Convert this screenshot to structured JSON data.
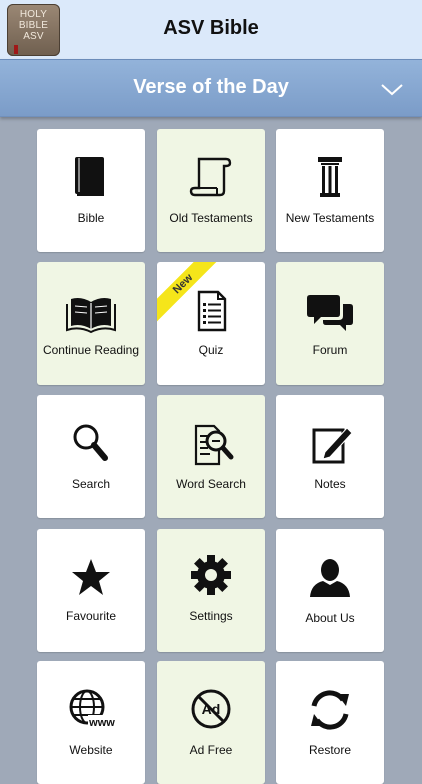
{
  "header": {
    "title": "ASV Bible",
    "logo_lines": [
      "HOLY",
      "BIBLE",
      "ASV"
    ]
  },
  "banner": {
    "title": "Verse of the Day",
    "toggle_icon": "chevron-down-icon"
  },
  "colors": {
    "header_bg": "#dbe9fa",
    "banner_bg": "#86a6d0",
    "page_bg": "#9fa9b8",
    "tile_white": "#ffffff",
    "tile_green": "#f0f6e4",
    "new_ribbon": "#f5e51a"
  },
  "tiles": [
    {
      "label": "Bible",
      "icon": "book-icon"
    },
    {
      "label": "Old Testaments",
      "icon": "scroll-icon"
    },
    {
      "label": "New Testaments",
      "icon": "column-icon"
    },
    {
      "label": "Continue Reading",
      "icon": "open-book-icon"
    },
    {
      "label": "Quiz",
      "icon": "quiz-icon",
      "badge": "New"
    },
    {
      "label": "Forum",
      "icon": "chat-bubbles-icon"
    },
    {
      "label": "Search",
      "icon": "magnifier-icon"
    },
    {
      "label": "Word Search",
      "icon": "document-search-icon"
    },
    {
      "label": "Notes",
      "icon": "note-edit-icon"
    },
    {
      "label": "Favourite",
      "icon": "star-icon"
    },
    {
      "label": "Settings",
      "icon": "gear-icon"
    },
    {
      "label": "About Us",
      "icon": "person-icon"
    },
    {
      "label": "Website",
      "icon": "globe-www-icon"
    },
    {
      "label": "Ad Free",
      "icon": "no-ads-icon"
    },
    {
      "label": "Restore",
      "icon": "restore-icon"
    }
  ]
}
